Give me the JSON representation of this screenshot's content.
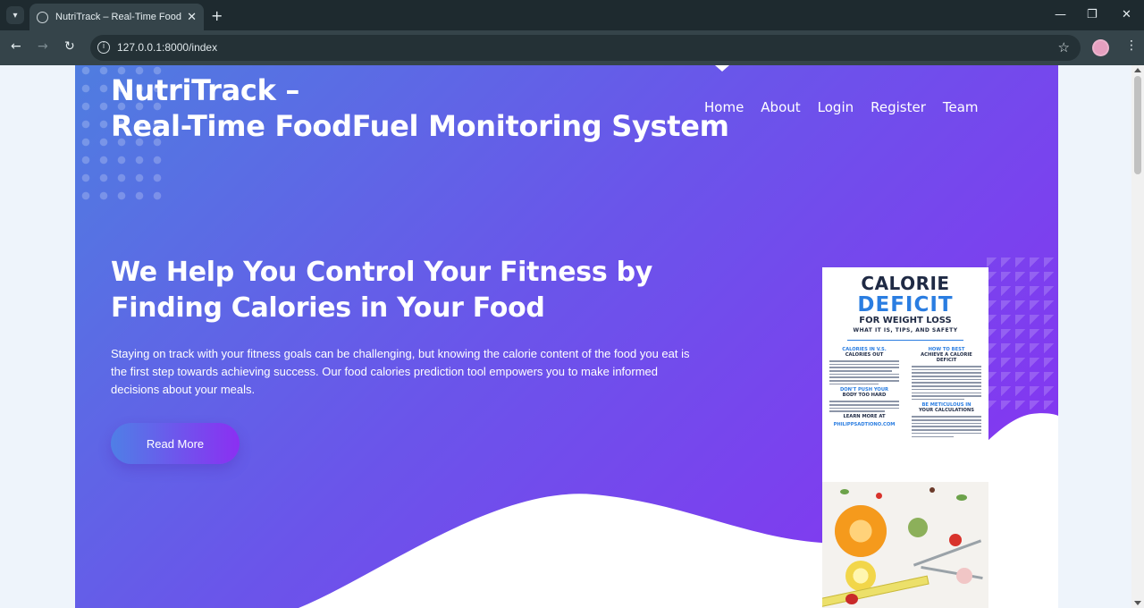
{
  "browser": {
    "tab_title": "NutriTrack – Real-Time FoodFuel Monitoring System",
    "url": "127.0.0.1:8000/index",
    "new_tab_symbol": "+",
    "close_symbol": "✕"
  },
  "site": {
    "brand_line1": "NutriTrack –",
    "brand_line2": "Real-Time FoodFuel Monitoring System",
    "nav": [
      "Home",
      "About",
      "Login",
      "Register",
      "Team"
    ]
  },
  "hero": {
    "headline": "We Help You Control Your Fitness by Finding Calories in Your Food",
    "lead": "Staying on track with your fitness goals can be challenging, but knowing the calorie content of the food you eat is the first step towards achieving success. Our food calories prediction tool empowers you to make informed decisions about your meals.",
    "cta": "Read More"
  },
  "poster": {
    "title1": "CALORIE",
    "title2": "DEFICIT",
    "title3": "FOR WEIGHT LOSS",
    "subtitle": "WHAT IT IS, TIPS, AND SAFETY",
    "col1_h1_blue": "CALORIES IN V.S.",
    "col1_h1_dark": "CALORIES OUT",
    "col1_h2_blue": "DON'T PUSH YOUR",
    "col1_h2_dark": "BODY TOO HARD",
    "col1_h3": "LEARN MORE AT",
    "col1_h3_link": "PHILIPPSADTIONO.COM",
    "col2_h1_blue": "HOW TO BEST",
    "col2_h1_dark": "ACHIEVE A CALORIE DEFICIT",
    "col2_h2_blue": "BE METICULOUS IN",
    "col2_h2_dark": "YOUR CALCULATIONS"
  },
  "colors": {
    "hero_start": "#4f7de0",
    "hero_end": "#8a2ff2",
    "poster_blue": "#2a7de1"
  }
}
